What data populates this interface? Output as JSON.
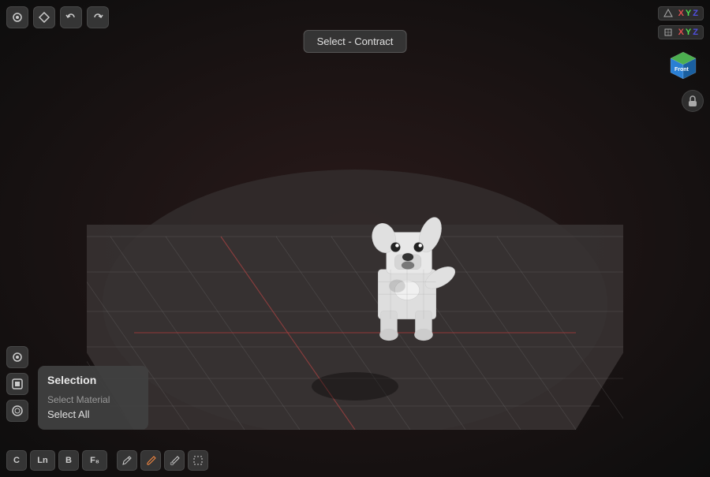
{
  "viewport": {
    "background": "dark"
  },
  "tooltip": {
    "text": "Select - Contract"
  },
  "top_toolbar": {
    "buttons": [
      {
        "name": "cursor-btn",
        "icon": "⊙",
        "label": "Cursor"
      },
      {
        "name": "diamond-btn",
        "icon": "◇",
        "label": "Diamond"
      },
      {
        "name": "undo-btn",
        "icon": "↩",
        "label": "Undo"
      },
      {
        "name": "redo-btn",
        "icon": "↪",
        "label": "Redo"
      }
    ]
  },
  "axis_top_right": {
    "row1": {
      "icon": "✦",
      "x": "X",
      "y": "Y",
      "z": "Z"
    },
    "row2": {
      "icon": "⊞",
      "x": "X",
      "y": "Y",
      "z": "Z"
    }
  },
  "front_cube": {
    "label": "Front"
  },
  "lock_icon": "🔒",
  "left_panel": {
    "icons": [
      {
        "name": "panel-icon-1",
        "icon": "⊙"
      },
      {
        "name": "panel-icon-2",
        "icon": "⬡"
      },
      {
        "name": "panel-icon-3",
        "icon": "◎"
      }
    ]
  },
  "selection_popup": {
    "title": "Selection",
    "items": [
      {
        "label": "Select Material",
        "active": false
      },
      {
        "label": "Select All",
        "active": true
      }
    ]
  },
  "bottom_toolbar": {
    "buttons": [
      {
        "name": "c-btn",
        "label": "C",
        "wide": false
      },
      {
        "name": "ln-btn",
        "label": "Ln",
        "wide": true
      },
      {
        "name": "b-btn",
        "label": "B",
        "wide": false
      },
      {
        "name": "f8-btn",
        "label": "F₈",
        "wide": true
      }
    ],
    "tools": [
      {
        "name": "pencil-tool",
        "icon": "✏",
        "highlighted": false
      },
      {
        "name": "brush-tool",
        "icon": "/",
        "highlighted": true
      },
      {
        "name": "eraser-tool",
        "icon": "✏",
        "highlighted": false
      },
      {
        "name": "select-tool",
        "icon": "⊡",
        "highlighted": false
      }
    ]
  }
}
